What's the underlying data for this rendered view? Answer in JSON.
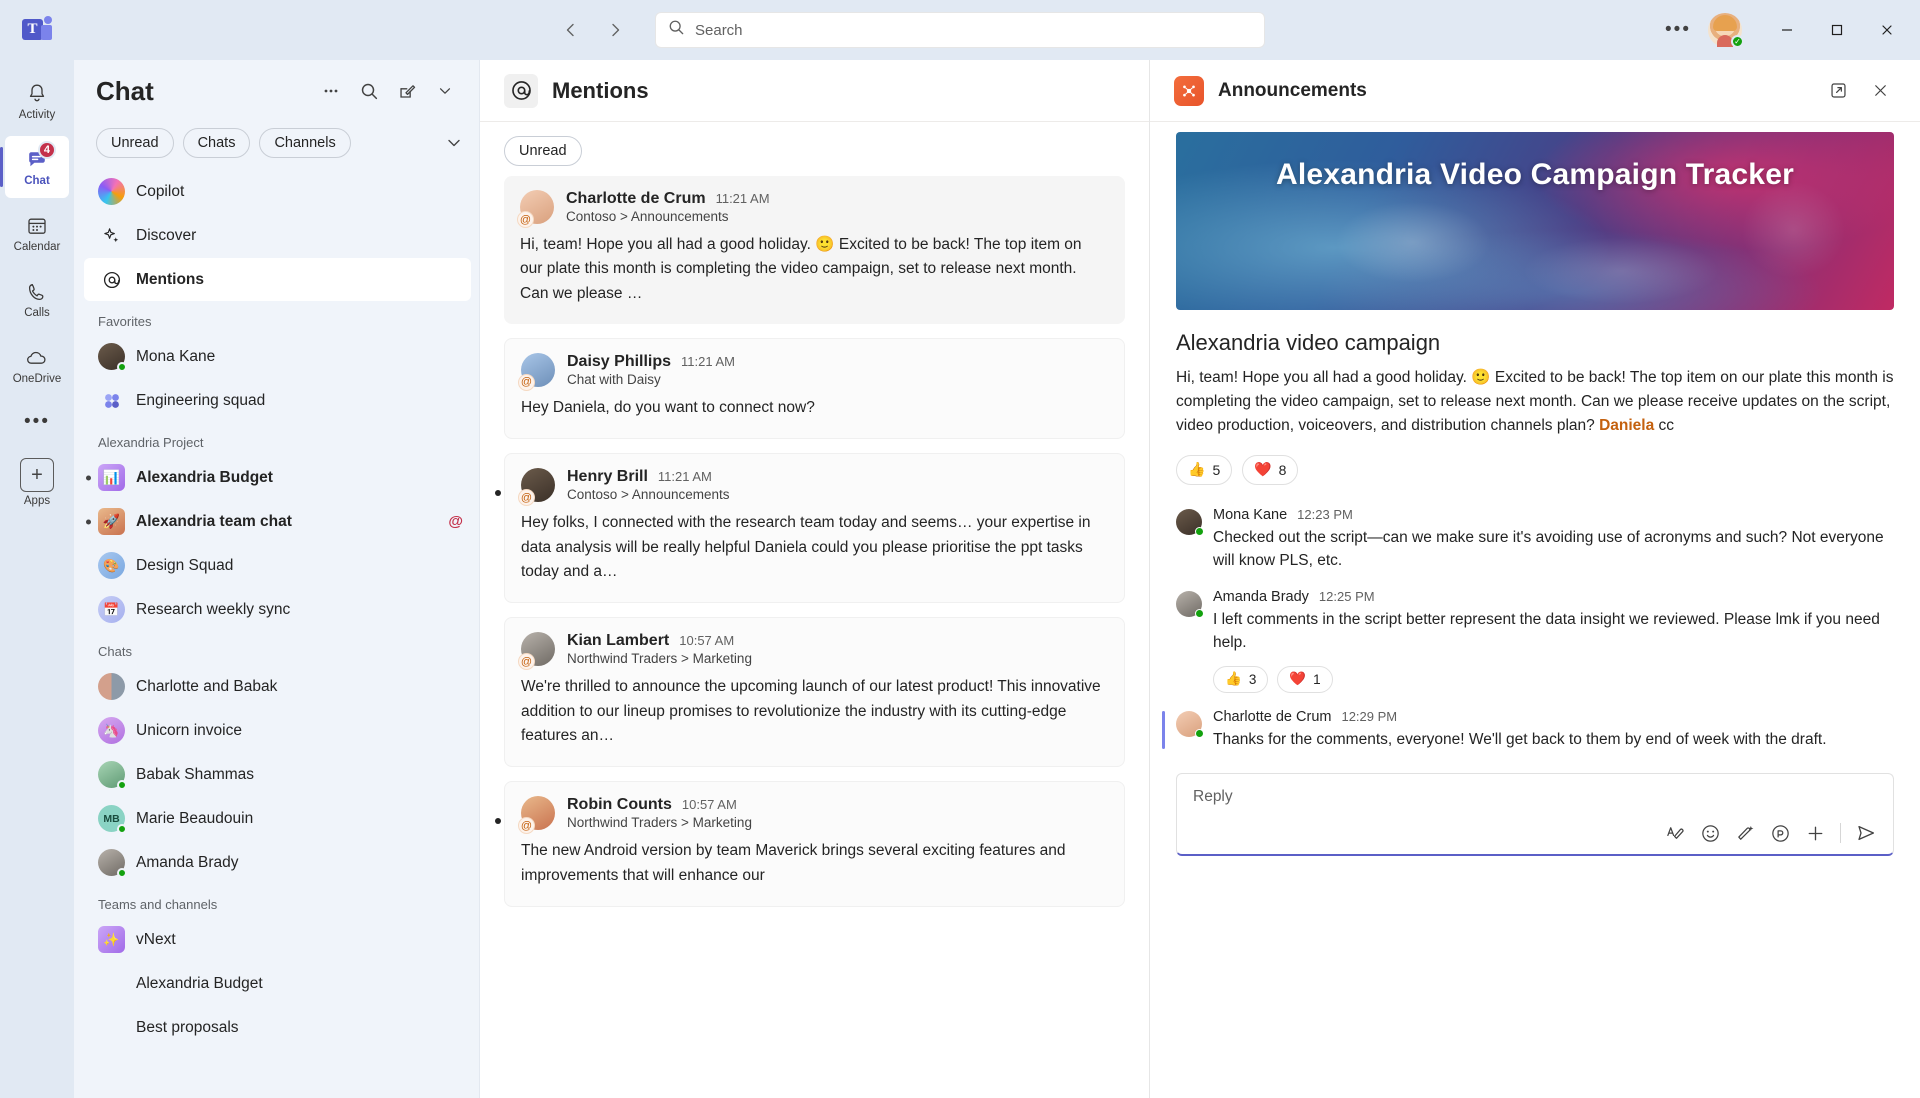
{
  "titlebar": {
    "logo_name": "microsoft-teams-logo",
    "back_label": "‹",
    "forward_label": "›",
    "search_placeholder": "Search",
    "more_label": "•••",
    "minimize_label": "─",
    "maximize_label": "□",
    "close_label": "✕"
  },
  "rail": {
    "items": [
      {
        "label": "Activity",
        "icon": "bell-icon",
        "badge": "",
        "active": false
      },
      {
        "label": "Chat",
        "icon": "chat-icon",
        "badge": "4",
        "active": true
      },
      {
        "label": "Calendar",
        "icon": "calendar-icon",
        "badge": "",
        "active": false
      },
      {
        "label": "Calls",
        "icon": "phone-icon",
        "badge": "",
        "active": false
      },
      {
        "label": "OneDrive",
        "icon": "cloud-icon",
        "badge": "",
        "active": false
      }
    ],
    "more_label": "•••",
    "apps_label": "Apps",
    "apps_glyph": "+"
  },
  "chatlist": {
    "title": "Chat",
    "header_icons": [
      "more-icon",
      "search-icon",
      "compose-icon",
      "chevron-down-icon"
    ],
    "filters": [
      "Unread",
      "Chats",
      "Channels"
    ],
    "pinned": [
      {
        "label": "Copilot",
        "icon": "copilot-icon"
      },
      {
        "label": "Discover",
        "icon": "sparkle-icon"
      },
      {
        "label": "Mentions",
        "icon": "at-icon",
        "selected": true
      }
    ],
    "sections": [
      {
        "title": "Favorites",
        "items": [
          {
            "label": "Mona Kane",
            "avatar": "photo",
            "style": "circ-dark",
            "presence": true,
            "unread": false
          },
          {
            "label": "Engineering squad",
            "avatar": "group",
            "style": "circ-lav",
            "presence": false,
            "unread": false
          }
        ]
      },
      {
        "title": "Alexandria Project",
        "items": [
          {
            "label": "Alexandria Budget",
            "avatar": "emoji",
            "glyph": "📊",
            "style": "circ-violet",
            "square": true,
            "unread": true
          },
          {
            "label": "Alexandria team chat",
            "avatar": "emoji",
            "glyph": "🚀",
            "style": "circ-warm",
            "square": true,
            "unread": true,
            "mention": "@"
          },
          {
            "label": "Design Squad",
            "avatar": "emoji",
            "glyph": "🎨",
            "style": "circ-sky",
            "unread": false
          },
          {
            "label": "Research weekly sync",
            "avatar": "emoji",
            "glyph": "📅",
            "style": "circ-ice",
            "unread": false
          }
        ]
      },
      {
        "title": "Chats",
        "items": [
          {
            "label": "Charlotte and Babak",
            "avatar": "duo",
            "style": "circ-split",
            "unread": false
          },
          {
            "label": "Unicorn invoice",
            "avatar": "emoji",
            "glyph": "🦄",
            "style": "circ-purple",
            "unread": false
          },
          {
            "label": "Babak Shammas",
            "avatar": "photo",
            "style": "circ-green",
            "presence": true,
            "unread": false
          },
          {
            "label": "Marie Beaudouin",
            "avatar": "initials",
            "initials": "MB",
            "style": "circ-teal",
            "presence": true,
            "unread": false
          },
          {
            "label": "Amanda Brady",
            "avatar": "photo",
            "style": "circ-gray",
            "presence": true,
            "unread": false
          }
        ]
      },
      {
        "title": "Teams and channels",
        "items": [
          {
            "label": "vNext",
            "avatar": "emoji",
            "glyph": "✨",
            "style": "circ-violet",
            "square": true,
            "unread": false
          },
          {
            "label": "Alexandria Budget",
            "avatar": "none",
            "unread": false
          },
          {
            "label": "Best proposals",
            "avatar": "none",
            "unread": false
          }
        ]
      }
    ]
  },
  "mentions": {
    "icon": "at-icon",
    "title": "Mentions",
    "filter": "Unread",
    "messages": [
      {
        "name": "Charlotte de Crum",
        "time": "11:21 AM",
        "location": "Contoso > Announcements",
        "text": "Hi, team! Hope you all had a good holiday. 🙂 Excited to be back! The top item on our plate this month is completing the video campaign, set to release next month. Can we please …",
        "avatar_style": "circ-rose",
        "unread": false,
        "card_style": "gray"
      },
      {
        "name": "Daisy Phillips",
        "time": "11:21 AM",
        "location": "Chat with Daisy",
        "text": "Hey Daniela, do you want to connect now?",
        "avatar_style": "circ-blue",
        "unread": false,
        "card_style": "white"
      },
      {
        "name": "Henry Brill",
        "time": "11:21 AM",
        "location": "Contoso > Announcements",
        "text": "Hey folks, I connected with the research team today and seems… your expertise in data analysis will be really helpful Daniela could you please prioritise the ppt tasks today and a…",
        "avatar_style": "circ-dark",
        "unread": true,
        "card_style": "white"
      },
      {
        "name": "Kian Lambert",
        "time": "10:57 AM",
        "location": "Northwind Traders > Marketing",
        "text": "We're thrilled to announce the upcoming launch of our latest product! This innovative addition to our lineup promises to revolutionize the industry with its cutting-edge features an…",
        "avatar_style": "circ-gray",
        "unread": false,
        "card_style": "white"
      },
      {
        "name": "Robin Counts",
        "time": "10:57 AM",
        "location": "Northwind Traders > Marketing",
        "text": "The new Android version by team Maverick brings several exciting features and improvements that will enhance our",
        "avatar_style": "circ-warm",
        "unread": true,
        "card_style": "white"
      }
    ]
  },
  "right_panel": {
    "app_icon": "announcements-app-icon",
    "title": "Announcements",
    "popout_icon": "popout-icon",
    "close_icon": "close-icon",
    "banner_title": "Alexandria Video Campaign Tracker",
    "post_title": "Alexandria video campaign",
    "post_body_1": "Hi, team! Hope you all had a good holiday. 🙂 Excited to be back! The top item on our plate this month is completing the video campaign, set to release next month. Can we please receive updates on the script, video production, voiceovers, and distribution channels plan? ",
    "post_mention": "Daniela",
    "post_body_2": " cc",
    "reactions": [
      {
        "emoji": "👍",
        "count": "5"
      },
      {
        "emoji": "❤️",
        "count": "8"
      }
    ],
    "replies": [
      {
        "name": "Mona Kane",
        "time": "12:23 PM",
        "text": "Checked out the script—can we make sure it's avoiding use of acronyms and such? Not everyone will know PLS, etc.",
        "avatar_style": "circ-dark",
        "highlight": false,
        "reactions": []
      },
      {
        "name": "Amanda Brady",
        "time": "12:25 PM",
        "text": "I left comments in the script better represent the data insight we reviewed. Please lmk if you need help.",
        "avatar_style": "circ-gray",
        "highlight": false,
        "reactions": [
          {
            "emoji": "👍",
            "count": "3"
          },
          {
            "emoji": "❤️",
            "count": "1"
          }
        ]
      },
      {
        "name": "Charlotte de Crum",
        "time": "12:29 PM",
        "text": "Thanks for the comments, everyone! We'll get back to them by end of week with the draft.",
        "avatar_style": "circ-rose",
        "highlight": true,
        "reactions": []
      }
    ],
    "composer": {
      "placeholder": "Reply",
      "tools": [
        "format-icon",
        "emoji-icon",
        "copilot-wand-icon",
        "praise-icon",
        "add-icon",
        "send-icon"
      ]
    }
  },
  "colors": {
    "accent": "#5b5fc7",
    "badge_red": "#c4314b",
    "mention_orange": "#c4610f",
    "presence_green": "#13a10e"
  }
}
